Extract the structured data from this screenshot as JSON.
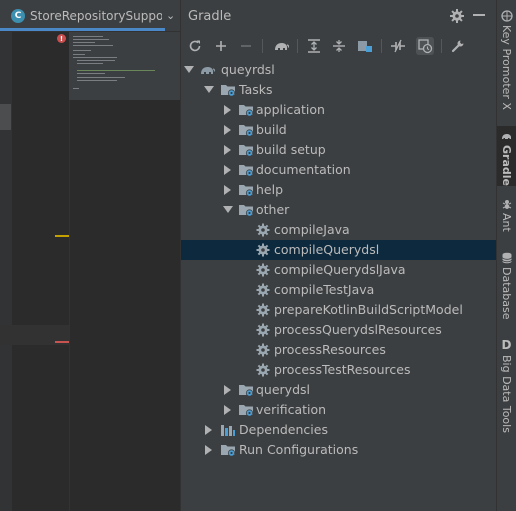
{
  "editor": {
    "tab_title": "StoreRepositorySupport.",
    "tab_icon_letter": "C",
    "error_glyph": "!"
  },
  "gradle": {
    "title": "Gradle",
    "toolbar": {
      "refresh": "refresh-icon",
      "add": "plus-icon",
      "remove": "minus-icon",
      "execute": "elephant-icon",
      "expand_all": "expand-all-icon",
      "collapse_all": "collapse-all-icon",
      "group_modules": "group-modules-icon",
      "toggle_offline": "offline-icon",
      "show_dependencies": "dependencies-icon",
      "settings": "wrench-icon"
    },
    "tree": [
      {
        "label": "queyrdsl",
        "depth": 0,
        "expanded": true,
        "icon": "gradle-elephant"
      },
      {
        "label": "Tasks",
        "depth": 1,
        "expanded": true,
        "icon": "task-folder"
      },
      {
        "label": "application",
        "depth": 2,
        "expanded": false,
        "icon": "task-folder"
      },
      {
        "label": "build",
        "depth": 2,
        "expanded": false,
        "icon": "task-folder"
      },
      {
        "label": "build setup",
        "depth": 2,
        "expanded": false,
        "icon": "task-folder"
      },
      {
        "label": "documentation",
        "depth": 2,
        "expanded": false,
        "icon": "task-folder"
      },
      {
        "label": "help",
        "depth": 2,
        "expanded": false,
        "icon": "task-folder"
      },
      {
        "label": "other",
        "depth": 2,
        "expanded": true,
        "icon": "task-folder"
      },
      {
        "label": "compileJava",
        "depth": 3,
        "icon": "gear"
      },
      {
        "label": "compileQuerydsl",
        "depth": 3,
        "icon": "gear",
        "selected": true
      },
      {
        "label": "compileQuerydslJava",
        "depth": 3,
        "icon": "gear"
      },
      {
        "label": "compileTestJava",
        "depth": 3,
        "icon": "gear"
      },
      {
        "label": "prepareKotlinBuildScriptModel",
        "depth": 3,
        "icon": "gear"
      },
      {
        "label": "processQuerydslResources",
        "depth": 3,
        "icon": "gear"
      },
      {
        "label": "processResources",
        "depth": 3,
        "icon": "gear"
      },
      {
        "label": "processTestResources",
        "depth": 3,
        "icon": "gear"
      },
      {
        "label": "querydsl",
        "depth": 2,
        "expanded": false,
        "icon": "task-folder"
      },
      {
        "label": "verification",
        "depth": 2,
        "expanded": false,
        "icon": "task-folder"
      },
      {
        "label": "Dependencies",
        "depth": 1,
        "expanded": false,
        "icon": "dependencies"
      },
      {
        "label": "Run Configurations",
        "depth": 1,
        "expanded": false,
        "icon": "task-folder"
      }
    ]
  },
  "right_strip": {
    "items": [
      {
        "label": "Key Promoter X",
        "icon": "key-promoter-icon"
      },
      {
        "label": "Gradle",
        "icon": "gradle-icon",
        "active": true
      },
      {
        "label": "Ant",
        "icon": "ant-icon"
      },
      {
        "label": "Database",
        "icon": "database-icon"
      },
      {
        "label": "Big Data Tools",
        "icon": "big-data-icon",
        "glyph": "D"
      }
    ]
  },
  "colors": {
    "background": "#2b2b2b",
    "panel": "#3c3f41",
    "selection": "#0d293e",
    "text": "#bbbbbb",
    "folder": "#9aa7b0",
    "task_badge": "#4a9fd6",
    "error": "#c94f4f"
  }
}
